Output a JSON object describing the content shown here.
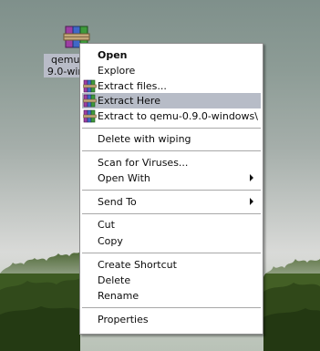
{
  "desktop": {
    "icon_label": "qemu-0.9.0-windows"
  },
  "context_menu": {
    "open": "Open",
    "explore": "Explore",
    "extract_files": "Extract files...",
    "extract_here": "Extract Here",
    "extract_to": "Extract to qemu-0.9.0-windows\\",
    "delete_wiping": "Delete with wiping",
    "scan_viruses": "Scan for Viruses...",
    "open_with": "Open With",
    "send_to": "Send To",
    "cut": "Cut",
    "copy": "Copy",
    "create_shortcut": "Create Shortcut",
    "delete": "Delete",
    "rename": "Rename",
    "properties": "Properties",
    "hovered_item": "Extract Here",
    "hover_color": "#b7bcc7"
  },
  "icons": {
    "archive": "winrar-archive-icon"
  }
}
